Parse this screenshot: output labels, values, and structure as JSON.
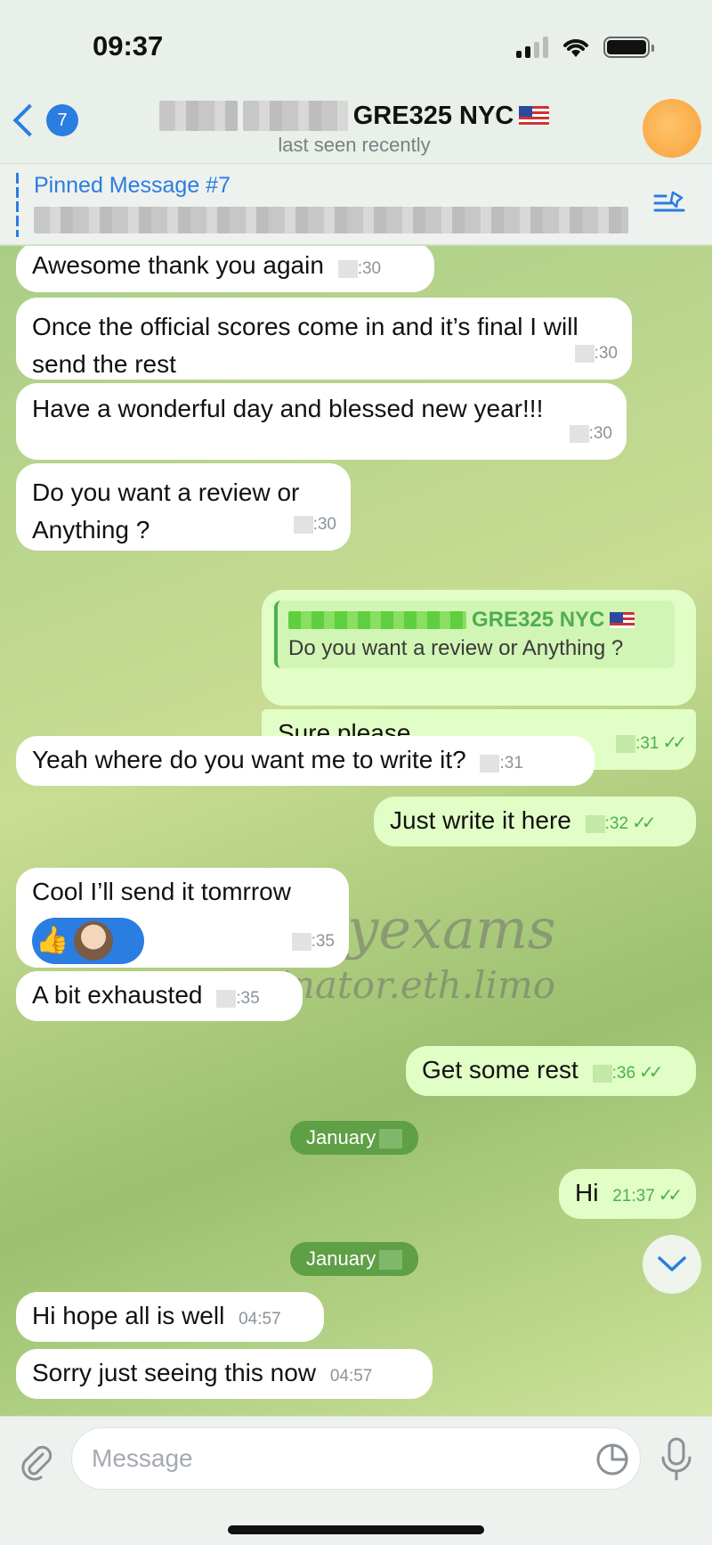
{
  "status_bar": {
    "time": "09:37"
  },
  "header": {
    "back_count": "7",
    "title": "GRE325 NYC",
    "subtitle": "last seen recently"
  },
  "pinned": {
    "title": "Pinned Message #7"
  },
  "messages": [
    {
      "direction": "in",
      "text": "Awesome thank you again",
      "time": ":30"
    },
    {
      "direction": "in",
      "text": "Once the official scores come in and it’s final I will send the rest",
      "time": ":30"
    },
    {
      "direction": "in",
      "text": "Have a wonderful day and blessed new year!!!",
      "time": ":30"
    },
    {
      "direction": "in",
      "text": "Do you want a review or Anything ?",
      "time": ":30"
    },
    {
      "direction": "out",
      "reply_author": "GRE325 NYC",
      "reply_text": "Do you want a review or Anything ?",
      "text": "Sure please",
      "time": ":31"
    },
    {
      "direction": "in",
      "text": "Yeah where do you want me to write it?",
      "time": ":31"
    },
    {
      "direction": "out",
      "text": "Just write it here",
      "time": ":32"
    },
    {
      "direction": "in",
      "text": "Cool I’ll send it tomrrow",
      "time": ":35",
      "reaction": "👍"
    },
    {
      "direction": "in",
      "text": "A bit exhausted",
      "time": ":35"
    },
    {
      "direction": "out",
      "text": "Get some rest",
      "time": ":36"
    },
    {
      "direction": "out",
      "text": "Hi",
      "time": "21:37"
    },
    {
      "direction": "in",
      "text": "Hi hope all is well",
      "time": "04:57"
    },
    {
      "direction": "in",
      "text": "Sorry just seeing this now",
      "time": "04:57"
    }
  ],
  "date_separators": [
    "January",
    "January"
  ],
  "watermark": {
    "line1": "@daisyexams",
    "line2": "examinator.eth.limo"
  },
  "composer": {
    "placeholder": "Message"
  },
  "colors": {
    "accent": "#2a7de1",
    "outgoing_bubble": "#e1fec6",
    "read_ticks": "#4fae4e",
    "date_pill": "#5f9f45"
  }
}
